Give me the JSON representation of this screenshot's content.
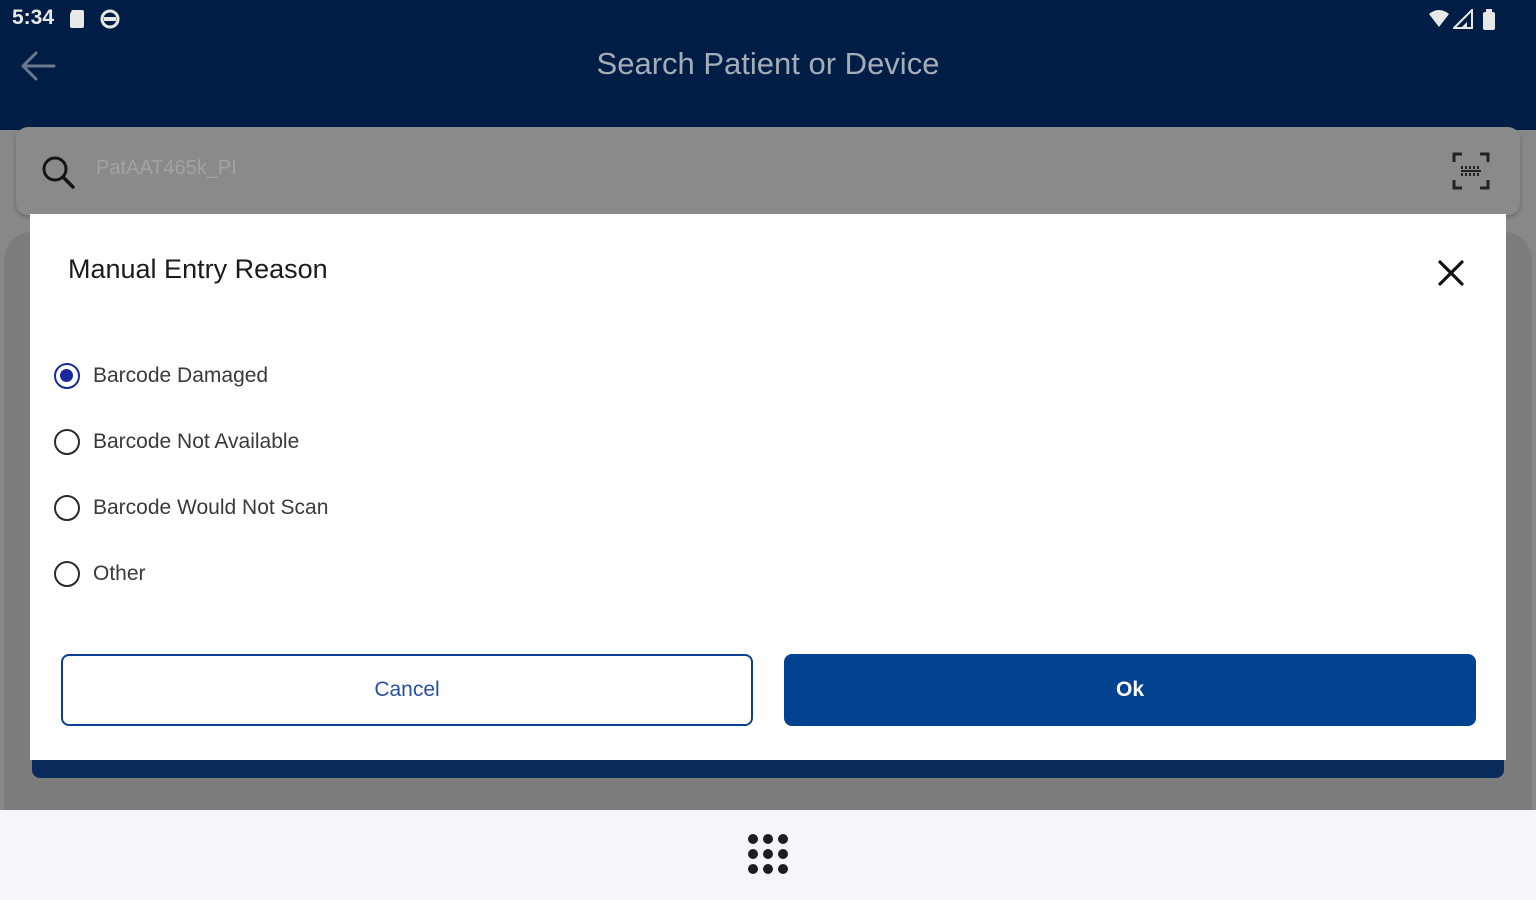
{
  "status_bar": {
    "time": "5:34"
  },
  "header": {
    "title": "Search Patient or Device"
  },
  "search": {
    "value": "PatAAT465k_PI"
  },
  "dialog": {
    "title": "Manual Entry Reason",
    "options": [
      {
        "label": "Barcode Damaged",
        "selected": true
      },
      {
        "label": "Barcode Not Available",
        "selected": false
      },
      {
        "label": "Barcode Would Not Scan",
        "selected": false
      },
      {
        "label": "Other",
        "selected": false
      }
    ],
    "cancel_label": "Cancel",
    "ok_label": "Ok"
  },
  "colors": {
    "header_bg": "#001e45",
    "primary": "#004190",
    "radio_selected": "#1a2a9c"
  }
}
